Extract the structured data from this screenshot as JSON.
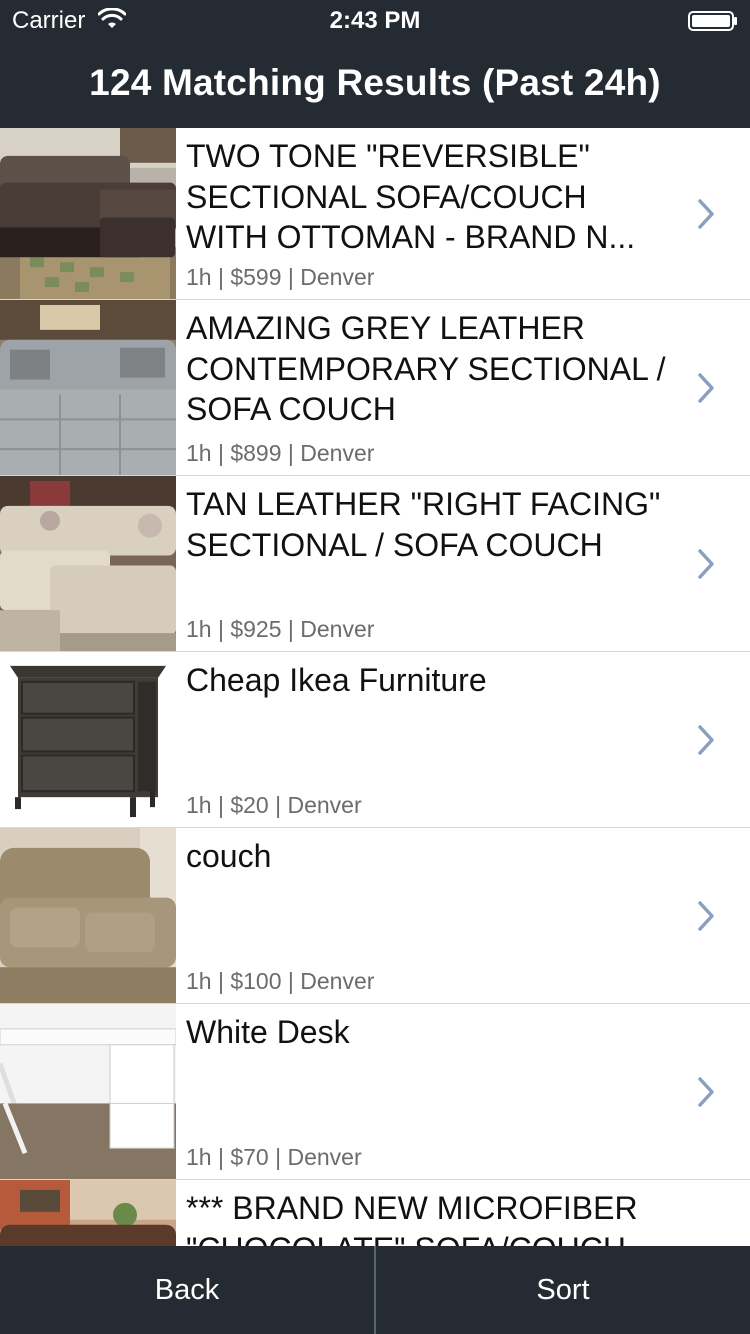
{
  "status_bar": {
    "carrier": "Carrier",
    "time": "2:43 PM",
    "icons": [
      "wifi-icon",
      "battery-icon"
    ]
  },
  "nav": {
    "title": "124 Matching Results (Past 24h)"
  },
  "listings": [
    {
      "title": "TWO TONE \"REVERSIBLE\" SECTIONAL SOFA/COUCH WITH OTTOMAN - BRAND N...",
      "meta": "1h | $599 | Denver"
    },
    {
      "title": "AMAZING GREY LEATHER CONTEMPORARY SECTIONAL / SOFA COUCH",
      "meta": "1h | $899 | Denver"
    },
    {
      "title": "TAN LEATHER \"RIGHT FACING\" SECTIONAL / SOFA COUCH",
      "meta": "1h | $925 | Denver"
    },
    {
      "title": "Cheap Ikea Furniture",
      "meta": "1h | $20 | Denver"
    },
    {
      "title": "couch",
      "meta": "1h | $100 | Denver"
    },
    {
      "title": "White Desk",
      "meta": "1h | $70 | Denver"
    },
    {
      "title": "*** BRAND NEW MICROFIBER \"CHOCOLATE\" SOFA/COUCH",
      "meta": ""
    }
  ],
  "tab_bar": {
    "back_label": "Back",
    "sort_label": "Sort"
  },
  "colors": {
    "bar_background": "#252b33",
    "chevron": "#8aa0bf",
    "meta_text": "#6c6c6c"
  }
}
